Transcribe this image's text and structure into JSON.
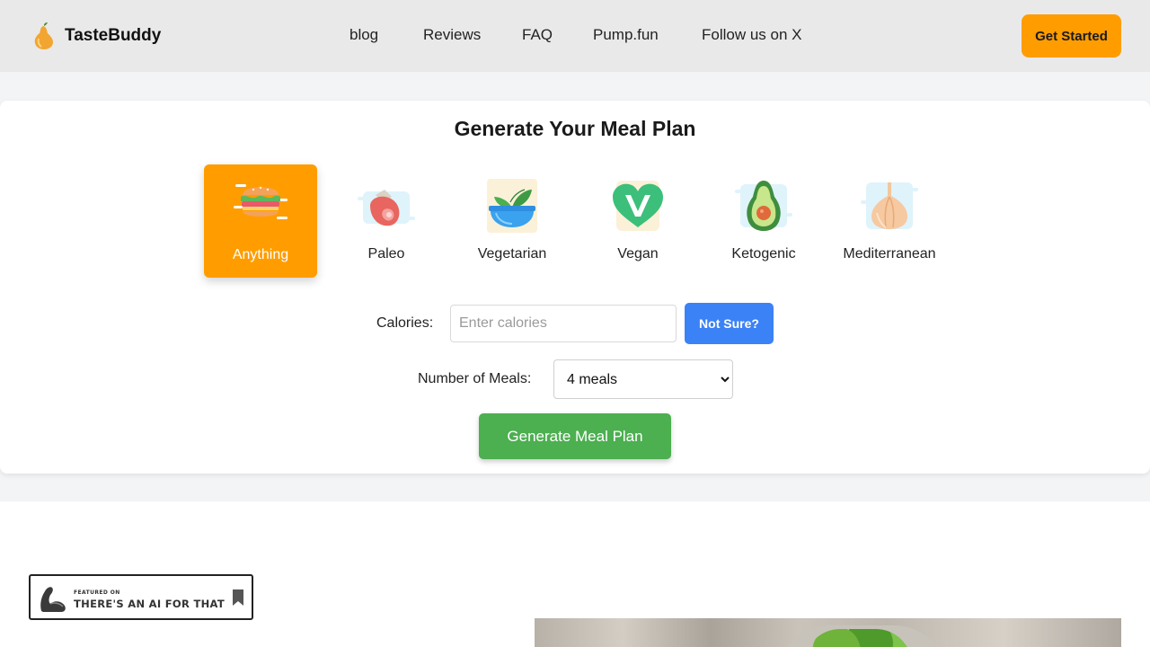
{
  "header": {
    "brand": "TasteBuddy",
    "nav": [
      "blog",
      "Reviews",
      "FAQ",
      "Pump.fun",
      "Follow us on X"
    ],
    "cta_label": "Get Started"
  },
  "planner": {
    "title": "Generate Your Meal Plan",
    "diets": [
      {
        "label": "Anything",
        "icon": "burger-icon",
        "selected": true
      },
      {
        "label": "Paleo",
        "icon": "meat-icon",
        "selected": false
      },
      {
        "label": "Vegetarian",
        "icon": "salad-bowl-icon",
        "selected": false
      },
      {
        "label": "Vegan",
        "icon": "vegan-heart-icon",
        "selected": false
      },
      {
        "label": "Ketogenic",
        "icon": "avocado-icon",
        "selected": false
      },
      {
        "label": "Mediterranean",
        "icon": "garlic-icon",
        "selected": false
      }
    ],
    "calories_label": "Calories:",
    "calories_value": "",
    "calories_placeholder": "Enter calories",
    "not_sure_label": "Not Sure?",
    "meals_label": "Number of Meals:",
    "meals_selected": "4 meals",
    "generate_label": "Generate Meal Plan"
  },
  "badge": {
    "small_text": "FEATURED ON",
    "big_text": "THERE'S AN AI FOR THAT"
  },
  "colors": {
    "accent": "#ff9d00",
    "blue": "#3b82f6",
    "green": "#4caf50",
    "header_bg": "#e9e9ea",
    "band_bg": "#f3f4f6"
  }
}
